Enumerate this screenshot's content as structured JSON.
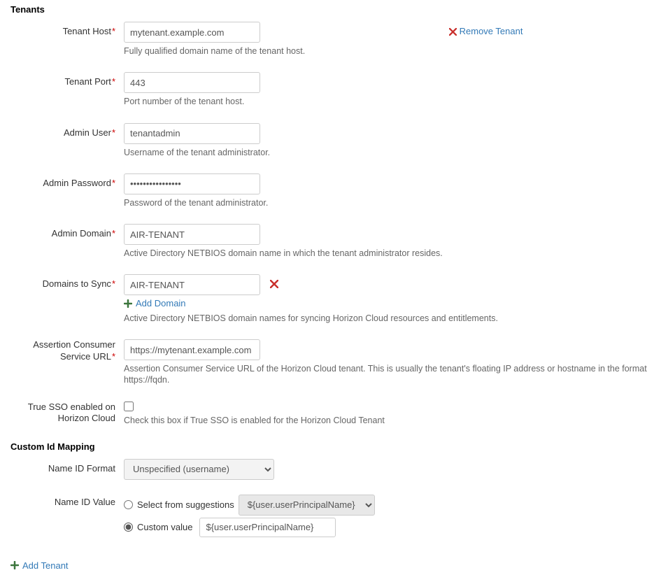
{
  "sections": {
    "tenants_title": "Tenants",
    "custom_id_mapping_title": "Custom Id Mapping"
  },
  "remove_tenant_label": "Remove Tenant",
  "fields": {
    "tenant_host": {
      "label": "Tenant Host",
      "value": "mytenant.example.com",
      "helper": "Fully qualified domain name of the tenant host."
    },
    "tenant_port": {
      "label": "Tenant Port",
      "value": "443",
      "helper": "Port number of the tenant host."
    },
    "admin_user": {
      "label": "Admin User",
      "value": "tenantadmin",
      "helper": "Username of the tenant administrator."
    },
    "admin_password": {
      "label": "Admin Password",
      "value": "••••••••••••••••",
      "helper": "Password of the tenant administrator."
    },
    "admin_domain": {
      "label": "Admin Domain",
      "value": "AIR-TENANT",
      "helper": "Active Directory NETBIOS domain name in which the tenant administrator resides."
    },
    "domains_to_sync": {
      "label": "Domains to Sync",
      "value": "AIR-TENANT",
      "helper": "Active Directory NETBIOS domain names for syncing Horizon Cloud resources and entitlements.",
      "add_label": "Add Domain"
    },
    "acs_url": {
      "label_l1": "Assertion Consumer",
      "label_l2": "Service URL",
      "value": "https://mytenant.example.com",
      "helper": "Assertion Consumer Service URL of the Horizon Cloud tenant. This is usually the tenant's floating IP address or hostname in the format https://fqdn."
    },
    "true_sso": {
      "label_l1": "True SSO enabled on",
      "label_l2": "Horizon Cloud",
      "helper": "Check this box if True SSO is enabled for the Horizon Cloud Tenant"
    },
    "nameid_format": {
      "label": "Name ID Format",
      "value": "Unspecified (username)"
    },
    "nameid_value": {
      "label": "Name ID Value",
      "suggestions_label": "Select from suggestions",
      "suggestion_value": "${user.userPrincipalName}",
      "custom_label": "Custom value",
      "custom_value": "${user.userPrincipalName}"
    }
  },
  "add_tenant_label": "Add Tenant"
}
